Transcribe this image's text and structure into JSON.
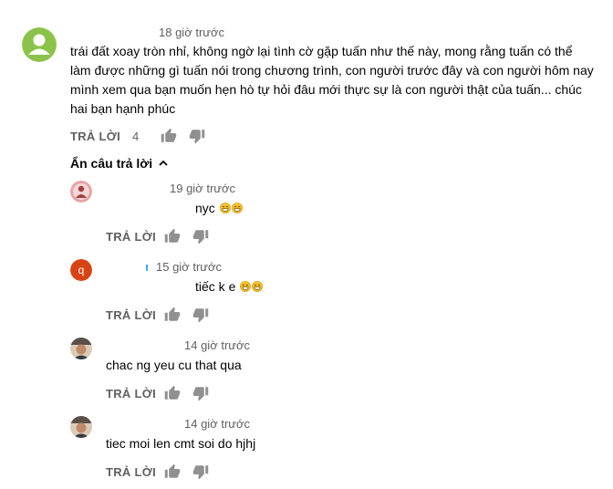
{
  "comment": {
    "time": "18 giờ trước",
    "text": "trái đất xoay tròn nhỉ, không ngờ lại tình cờ gặp tuấn như thế này, mong rằng tuấn có thể làm được những gì tuấn nói trong chương trình, con người trước đây và con người hôm nay mình xem qua bạn muốn hẹn hò tự hỏi đâu mới thực sự là con người thật của tuấn... chúc hai bạn hạnh phúc",
    "reply_label": "TRẢ LỜI",
    "like_count": "4",
    "avatar_color": "#8bc34a"
  },
  "toggle": {
    "label": "Ẩn câu trả lời"
  },
  "replies": [
    {
      "time": "19 giờ trước",
      "text": "nyc",
      "emoji_count": 2,
      "reply_label": "TRẢ LỜI"
    },
    {
      "avatar_letter": "q",
      "avatar_color": "#d84315",
      "time": "15 giờ trước",
      "text": "tiếc k e",
      "emoji_count": 2,
      "reply_label": "TRẢ LỜI"
    },
    {
      "time": "14 giờ trước",
      "text": "chac ng yeu cu that qua",
      "reply_label": "TRẢ LỜI"
    },
    {
      "time": "14 giờ trước",
      "text": "tiec moi len cmt soi do hjhj",
      "reply_label": "TRẢ LỜI"
    }
  ]
}
